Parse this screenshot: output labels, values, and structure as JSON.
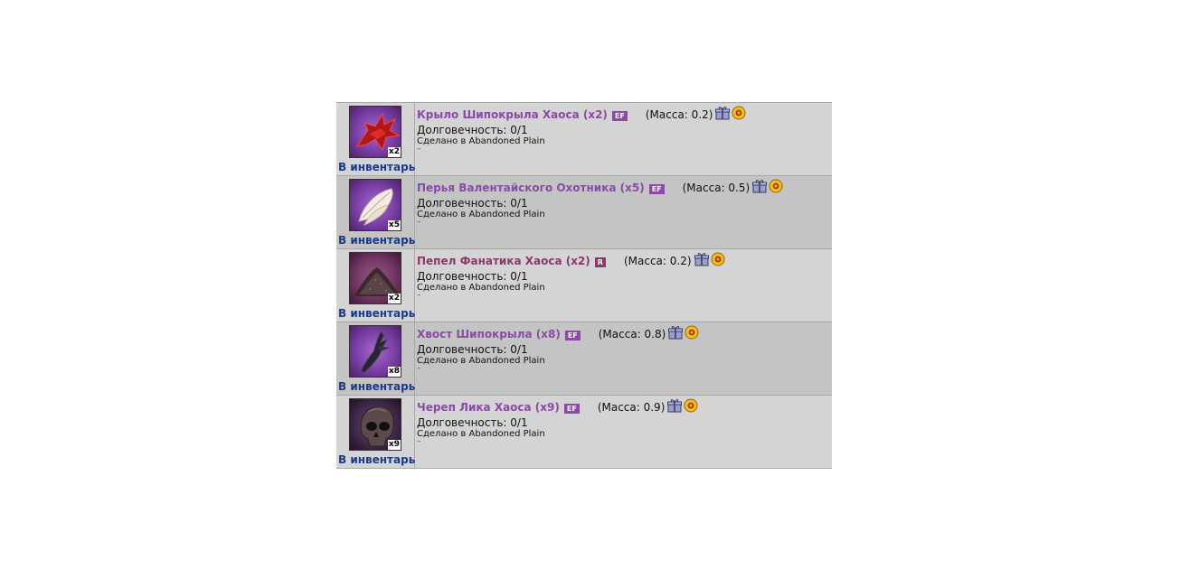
{
  "inventory_label": "В инвентарь",
  "durability_prefix": "Долговечность: ",
  "made_prefix": "Сделано в ",
  "dash": "–",
  "items": [
    {
      "name": "Крыло Шипокрыла Хаоса (x2)",
      "badge": "EF",
      "mass": "(Масса: 0.2)",
      "durability": "0/1",
      "origin": "Abandoned Plain",
      "qty": "x2",
      "icon": "chaos-wing-icon"
    },
    {
      "name": "Перья Валентайского Охотника (x5)",
      "badge": "EF",
      "mass": "(Масса: 0.5)",
      "durability": "0/1",
      "origin": "Abandoned Plain",
      "qty": "x5",
      "icon": "feathers-icon"
    },
    {
      "name": "Пепел Фанатика Хаоса (x2)",
      "badge": "R",
      "mass": "(Масса: 0.2)",
      "durability": "0/1",
      "origin": "Abandoned Plain",
      "qty": "x2",
      "icon": "ash-pile-icon"
    },
    {
      "name": "Хвост Шипокрыла (x8)",
      "badge": "EF",
      "mass": "(Масса: 0.8)",
      "durability": "0/1",
      "origin": "Abandoned Plain",
      "qty": "x8",
      "icon": "tail-icon"
    },
    {
      "name": "Череп Лика Хаоса (x9)",
      "badge": "EF",
      "mass": "(Масса: 0.9)",
      "durability": "0/1",
      "origin": "Abandoned Plain",
      "qty": "x9",
      "icon": "skull-icon"
    }
  ]
}
